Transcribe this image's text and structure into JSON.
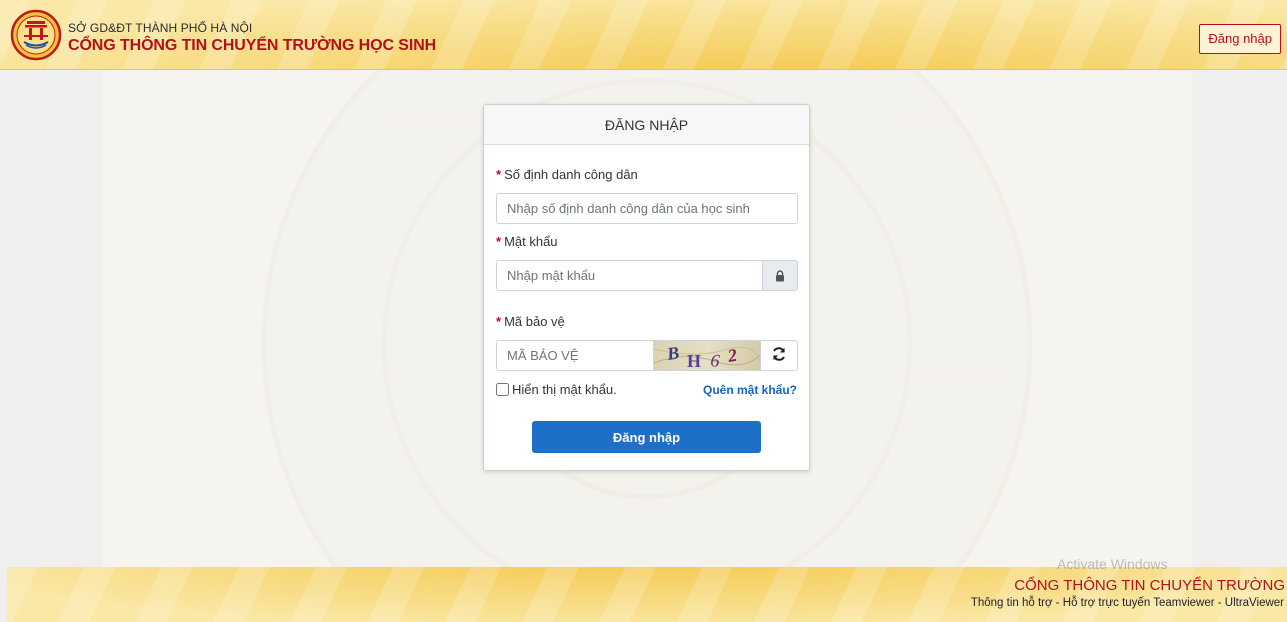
{
  "header": {
    "org_title": "SỞ GD&ĐT THÀNH PHỐ HÀ NỘI",
    "portal_title": "CỔNG THÔNG TIN CHUYỂN TRƯỜNG HỌC SINH",
    "login_button": "Đăng nhập",
    "logo_icon": "hanoi-emblem-icon"
  },
  "login_form": {
    "title": "ĐĂNG NHẬP",
    "citizen_id": {
      "label": "Số định danh công dân",
      "placeholder": "Nhập số định danh công dân của học sinh",
      "value": ""
    },
    "password": {
      "label": "Mật khẩu",
      "placeholder": "Nhập mật khẩu",
      "value": "",
      "icon": "lock-icon"
    },
    "captcha": {
      "label": "Mã bảo vệ",
      "placeholder": "MÃ BẢO VỆ",
      "value": "",
      "image_text": "BH62",
      "refresh_icon": "refresh-icon"
    },
    "show_password": {
      "label": "Hiển thị mật khẩu.",
      "checked": false
    },
    "forgot_password": "Quên mật khẩu?",
    "submit": "Đăng nhập"
  },
  "system": {
    "watermark": "Activate Windows"
  },
  "footer": {
    "title": "CỔNG THÔNG TIN CHUYỂN TRƯỜNG",
    "links": "Thông tin hỗ trợ - Hỗ trợ trực tuyến Teamviewer - UltraViewer"
  },
  "colors": {
    "brand_red": "#b5101a",
    "primary_blue": "#1e6fc7",
    "header_gold": "#f8dc82"
  }
}
